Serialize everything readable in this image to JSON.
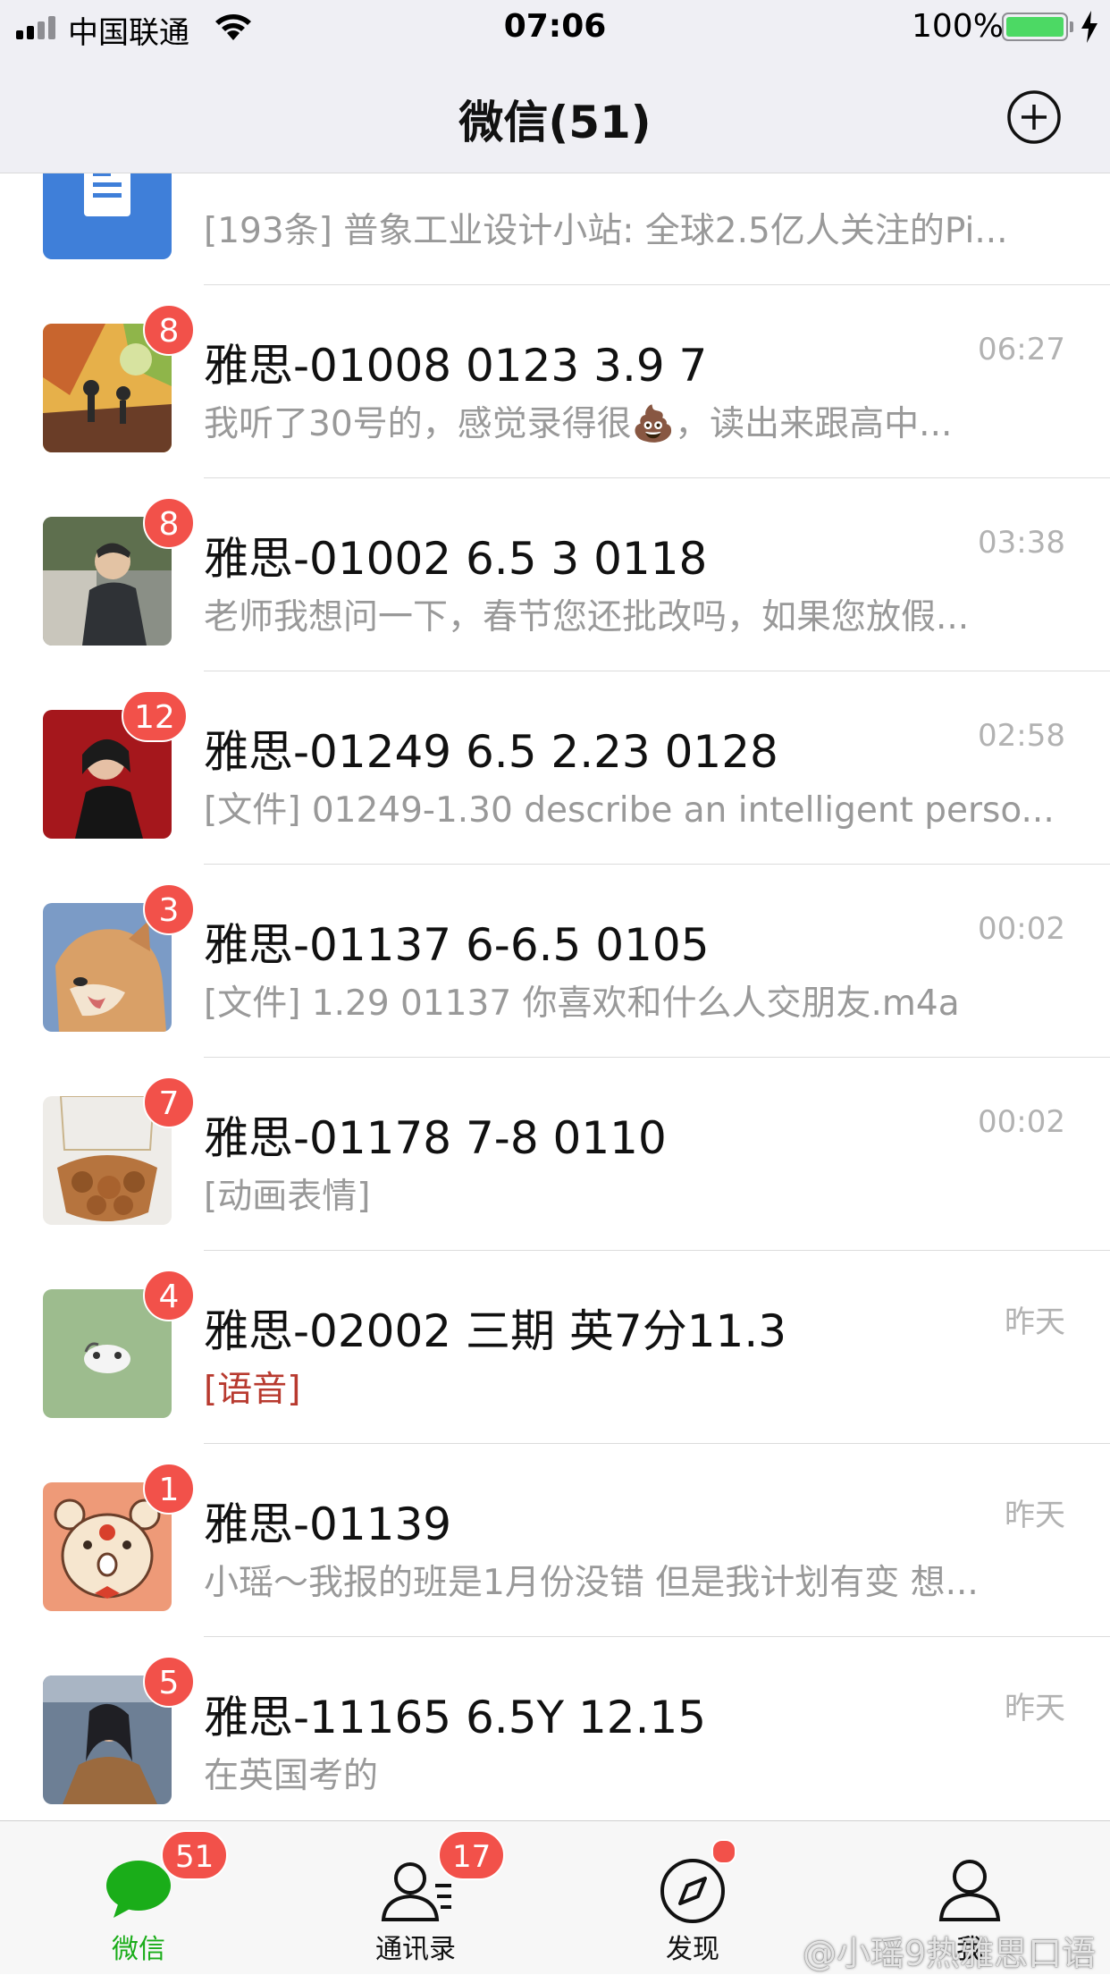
{
  "status_bar": {
    "carrier": "中国联通",
    "time": "07:06",
    "battery_percent": "100%",
    "battery_level": 1.0,
    "charging": true
  },
  "nav": {
    "title": "微信(51)",
    "add_icon": "plus-circle-icon"
  },
  "chats": [
    {
      "name": "",
      "time": "",
      "message": "[193条] 普象工业设计小站: 全球2.5亿人关注的Pi...",
      "badge": "",
      "avatar_icon": "subscription-doc-icon",
      "message_color": "gray"
    },
    {
      "name": "雅思-01008 0123 3.9 7",
      "time": "06:27",
      "message": "我听了30号的，感觉录得很💩，读出来跟高中...",
      "badge": "8",
      "avatar_icon": "cartoon-avatar",
      "message_color": "gray"
    },
    {
      "name": "雅思-01002 6.5 3 0118",
      "time": "03:38",
      "message": "老师我想问一下，春节您还批改吗，如果您放假...",
      "badge": "8",
      "avatar_icon": "person-photo-avatar",
      "message_color": "gray"
    },
    {
      "name": "雅思-01249 6.5 2.23 0128",
      "time": "02:58",
      "message": "[文件] 01249-1.30 describe an intelligent perso...",
      "badge": "12",
      "avatar_icon": "person-red-bg-avatar",
      "message_color": "gray"
    },
    {
      "name": "雅思-01137 6-6.5 0105",
      "time": "00:02",
      "message": "[文件] 1.29 01137 你喜欢和什么人交朋友.m4a",
      "badge": "3",
      "avatar_icon": "shiba-dog-avatar",
      "message_color": "gray"
    },
    {
      "name": "雅思-01178 7-8 0110",
      "time": "00:02",
      "message": "[动画表情]",
      "badge": "7",
      "avatar_icon": "net-bag-avatar",
      "message_color": "gray"
    },
    {
      "name": "雅思-02002 三期 英7分11.3",
      "time": "昨天",
      "message": "[语音]",
      "badge": "4",
      "avatar_icon": "green-cartoon-avatar",
      "message_color": "red"
    },
    {
      "name": "雅思-01139",
      "time": "昨天",
      "message": "小瑶～我报的班是1月份没错 但是我计划有变 想...",
      "badge": "1",
      "avatar_icon": "bear-cartoon-avatar",
      "message_color": "gray"
    },
    {
      "name": "雅思-11165 6.5Y 12.15",
      "time": "昨天",
      "message": "在英国考的",
      "badge": "5",
      "avatar_icon": "woman-photo-avatar",
      "message_color": "gray"
    }
  ],
  "tabs": [
    {
      "label": "微信",
      "badge": "51",
      "active": true,
      "icon": "chat-bubble-icon"
    },
    {
      "label": "通讯录",
      "badge": "17",
      "active": false,
      "icon": "contacts-icon"
    },
    {
      "label": "发现",
      "badge": "",
      "dot": true,
      "active": false,
      "icon": "compass-icon"
    },
    {
      "label": "我",
      "badge": "",
      "active": false,
      "icon": "profile-icon"
    }
  ],
  "watermark": "@小瑶9热雅思口语",
  "colors": {
    "accent_green": "#1aad19",
    "badge_red": "#f2514a",
    "bar_bg": "#efeff4",
    "voice_red": "#b83a2f"
  }
}
